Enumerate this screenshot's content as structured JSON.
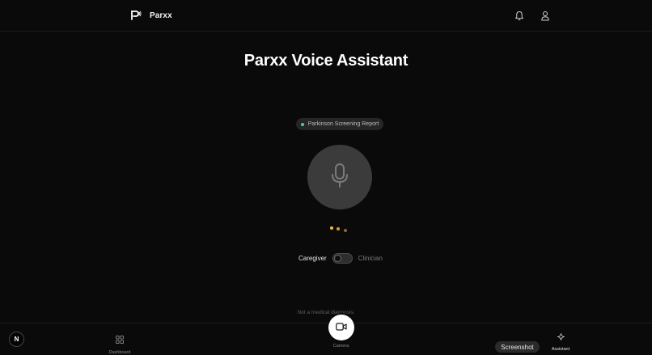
{
  "header": {
    "brand_name": "Parxx",
    "logo_icon": "parxx-logo-icon",
    "icons": [
      "bell-icon",
      "user-icon"
    ]
  },
  "main": {
    "title": "Parxx Voice Assistant",
    "context_chip": {
      "label": "Parkinson Screening Report",
      "status_color": "#3ddc84"
    },
    "mic_icon": "microphone-icon",
    "loader_colors": [
      "#f5b942",
      "#d99a2b",
      "#8a6a3a"
    ],
    "role_toggle": {
      "left_label": "Caregiver",
      "right_label": "Clinician",
      "selected": "Caregiver"
    },
    "disclaimer": "Not a medical diagnosis."
  },
  "bottom_nav": {
    "badge": "N",
    "items": [
      {
        "label": "Dashboard",
        "icon": "grid-icon"
      },
      {
        "label": "Camera",
        "icon": "video-camera-icon"
      },
      {
        "label": "Assistant",
        "icon": "sparkle-icon",
        "active": true
      }
    ],
    "tooltip": "Screenshot"
  }
}
